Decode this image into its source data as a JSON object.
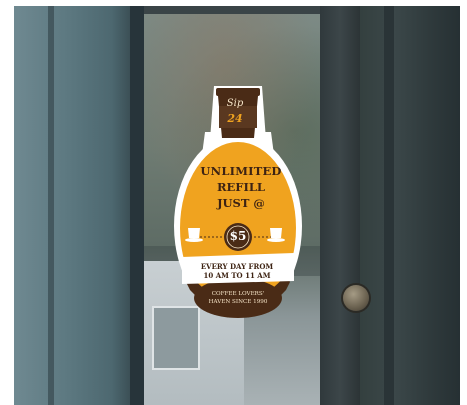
{
  "sticker": {
    "cup_text_line1": "Sip",
    "cup_text_line2": "24",
    "headline_line1": "UNLIMITED",
    "headline_line2": "REFILL",
    "headline_line3": "JUST @",
    "price": "$5",
    "banner_line1": "EVERY DAY FROM",
    "banner_line2": "10 AM TO 11 AM",
    "footer_line1": "COFFEE LOVERS'",
    "footer_line2": "HAVEN SINCE 1990",
    "colors": {
      "orange": "#f0a31f",
      "brown": "#4a2b16",
      "cream": "#f7e6c9",
      "white": "#ffffff"
    },
    "icons": [
      "coffee-cup-icon",
      "saucer-cup-icon"
    ]
  }
}
